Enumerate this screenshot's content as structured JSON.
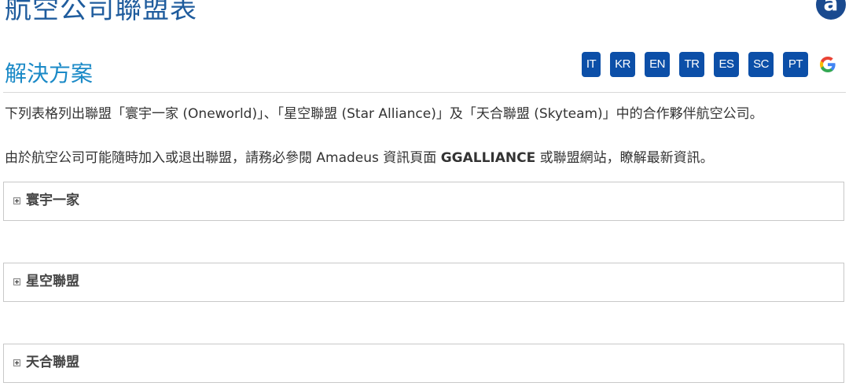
{
  "page": {
    "title": "航空公司聯盟表",
    "logo_letter": "a"
  },
  "section": {
    "heading": "解決方案"
  },
  "languages": [
    {
      "code": "IT"
    },
    {
      "code": "KR"
    },
    {
      "code": "EN"
    },
    {
      "code": "TR"
    },
    {
      "code": "ES"
    },
    {
      "code": "SC"
    },
    {
      "code": "PT"
    }
  ],
  "google_icon": {
    "glyph": "G"
  },
  "intro": {
    "text": "下列表格列出聯盟「寰宇一家 (Oneworld)」、「星空聯盟 (Star Alliance)」及「天合聯盟 (Skyteam)」中的合作夥伴航空公司。"
  },
  "notice": {
    "prefix": "由於航空公司可能隨時加入或退出聯盟，請務必參閱 Amadeus 資訊頁面 ",
    "bold": "GGALLIANCE",
    "suffix": " 或聯盟網站，瞭解最新資訊。"
  },
  "panels": [
    {
      "title": "寰宇一家"
    },
    {
      "title": "星空聯盟"
    },
    {
      "title": "天合聯盟"
    }
  ],
  "colors": {
    "title": "#1f5c9d",
    "heading": "#1b8ac7",
    "lang_button": "#0c4fa8",
    "logo": "#1a4a8f"
  }
}
